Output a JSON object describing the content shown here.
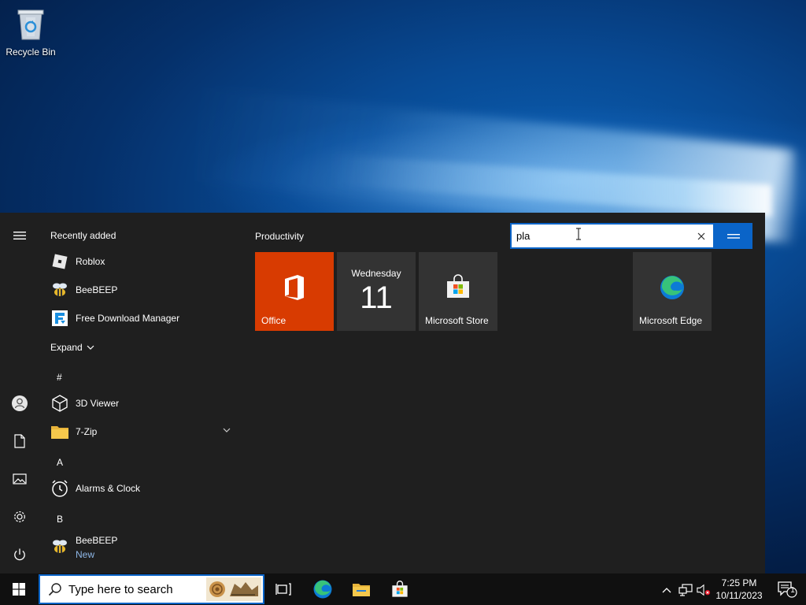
{
  "desktop": {
    "recycle_bin_label": "Recycle Bin"
  },
  "start_menu": {
    "recently_added_header": "Recently added",
    "recent_apps": [
      {
        "name": "Roblox",
        "icon": "roblox-icon"
      },
      {
        "name": "BeeBEEP",
        "icon": "bee-icon"
      },
      {
        "name": "Free Download Manager",
        "icon": "fdm-icon"
      }
    ],
    "expand_label": "Expand",
    "sections": {
      "hash": "#",
      "a": "A",
      "b": "B"
    },
    "apps": {
      "viewer3d": "3D Viewer",
      "sevenzip": "7-Zip",
      "alarms": "Alarms & Clock",
      "beebeep": "BeeBEEP",
      "beebeep_badge": "New"
    },
    "group_title": "Productivity",
    "tiles": {
      "office": "Office",
      "calendar_day": "Wednesday",
      "calendar_date": "11",
      "store": "Microsoft Store",
      "edge": "Microsoft Edge"
    },
    "search": {
      "value": "pla"
    }
  },
  "taskbar": {
    "search_placeholder": "Type here to search",
    "time": "7:25 PM",
    "date": "10/11/2023",
    "notification_count": "1"
  },
  "colors": {
    "accent": "#0a64c8",
    "office_tile": "#d83b01",
    "menu_bg": "#1f1f1f",
    "taskbar_bg": "#101010"
  }
}
